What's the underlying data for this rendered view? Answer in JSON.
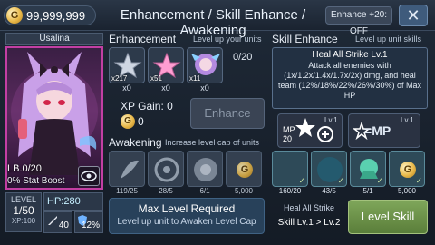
{
  "topbar": {
    "gold": "99,999,999",
    "title": "Enhancement / Skill Enhance / Awakening",
    "enhance_plus20": "Enhance +20: OFF",
    "close_icon": "close-icon"
  },
  "character": {
    "name": "Usalina",
    "limit_break": "LB.0/20",
    "stat_boost": "0% Stat Boost",
    "level_label": "LEVEL",
    "level": "1/50",
    "xp": "XP:100",
    "hp": "HP:280",
    "atk": "40",
    "def": "12%"
  },
  "enhancement": {
    "title": "Enhancement",
    "subtitle": "Level up your units",
    "count": "0/20",
    "slots": [
      {
        "count": "x217",
        "used": "x0"
      },
      {
        "count": "x51",
        "used": "x0"
      },
      {
        "count": "x11",
        "used": "x0"
      }
    ],
    "xp_gain": "XP Gain: 0",
    "cost": "0",
    "button": "Enhance"
  },
  "awakening": {
    "title": "Awakening",
    "subtitle": "Increase level cap of units",
    "values": [
      "119/25",
      "28/5",
      "6/1",
      "5,000"
    ],
    "max_level_title": "Max Level Required",
    "max_level_desc": "Level up unit to Awaken Level Cap"
  },
  "skill": {
    "title": "Skill Enhance",
    "subtitle": "Level up unit skills",
    "name": "Heal All Strike Lv.1",
    "description": "Attack all enemies with (1x/1.2x/1.4x/1.7x/2x) dmg, and heal team (12%/18%/22%/26%/30%) of Max HP",
    "mp": "20",
    "mp_label": "MP",
    "lv_a": "Lv.1",
    "lv_b": "Lv.1",
    "values": [
      "160/20",
      "43/5",
      "5/1",
      "5,000"
    ],
    "heal_label": "Heal All Strike",
    "heal_levels": "Skill Lv.1 > Lv.2",
    "button": "Level Skill"
  },
  "colors": {
    "accent": "#c23fa3",
    "button_green": "#6b9448",
    "panel": "#2d3a4b"
  }
}
